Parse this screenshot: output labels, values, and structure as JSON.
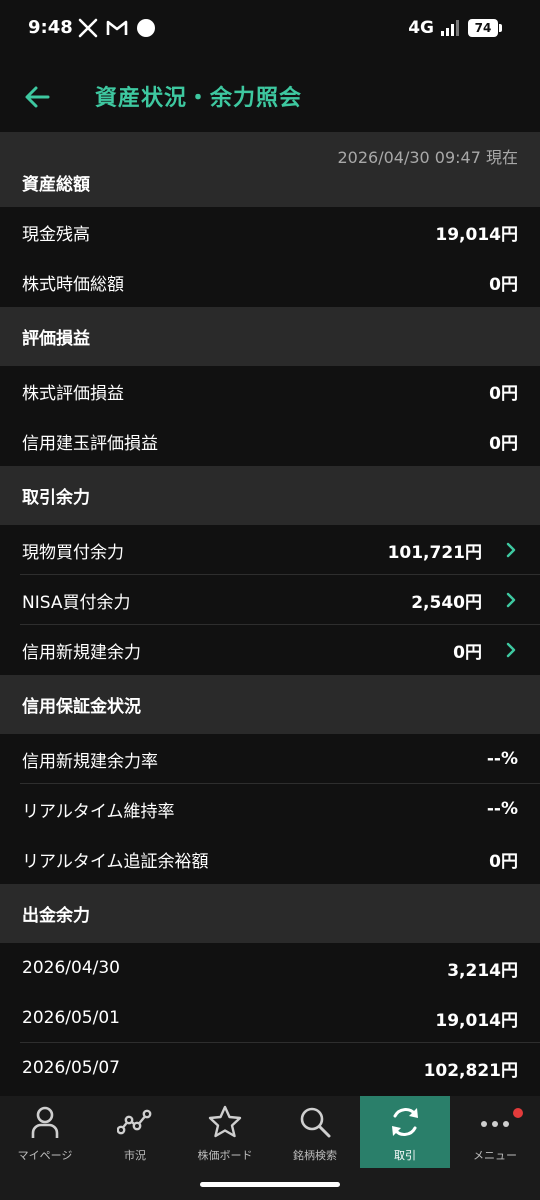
{
  "status": {
    "time": "9:48",
    "network": "4G",
    "battery": "74"
  },
  "header": {
    "title": "資産状況・余力照会"
  },
  "timestamp": "2026/04/30 09:47 現在",
  "sections": {
    "assets": {
      "title": "資産総額",
      "rows": [
        {
          "label": "現金残高",
          "value": "19,014円"
        },
        {
          "label": "株式時価総額",
          "value": "0円"
        }
      ]
    },
    "pnl": {
      "title": "評価損益",
      "rows": [
        {
          "label": "株式評価損益",
          "value": "0円"
        },
        {
          "label": "信用建玉評価損益",
          "value": "0円"
        }
      ]
    },
    "power": {
      "title": "取引余力",
      "rows": [
        {
          "label": "現物買付余力",
          "value": "101,721円"
        },
        {
          "label": "NISA買付余力",
          "value": "2,540円"
        },
        {
          "label": "信用新規建余力",
          "value": "0円"
        }
      ]
    },
    "margin": {
      "title": "信用保証金状況",
      "rows": [
        {
          "label": "信用新規建余力率",
          "value": "--%"
        },
        {
          "label": "リアルタイム維持率",
          "value": "--%"
        },
        {
          "label": "リアルタイム追証余裕額",
          "value": "0円"
        }
      ]
    },
    "withdraw": {
      "title": "出金余力",
      "rows": [
        {
          "label": "2026/04/30",
          "value": "3,214円"
        },
        {
          "label": "2026/05/01",
          "value": "19,014円"
        },
        {
          "label": "2026/05/07",
          "value": "102,821円"
        }
      ]
    }
  },
  "nav": {
    "items": [
      {
        "label": "マイページ",
        "icon": "person-icon"
      },
      {
        "label": "市況",
        "icon": "market-graph-icon"
      },
      {
        "label": "株価ボード",
        "icon": "star-icon"
      },
      {
        "label": "銘柄検索",
        "icon": "search-icon"
      },
      {
        "label": "取引",
        "icon": "trade-cycle-icon"
      },
      {
        "label": "メニュー",
        "icon": "more-dots-icon"
      }
    ]
  },
  "colors": {
    "accent": "#3ec8a0",
    "active_nav": "#2a7f6a",
    "notification": "#e33b3b"
  }
}
